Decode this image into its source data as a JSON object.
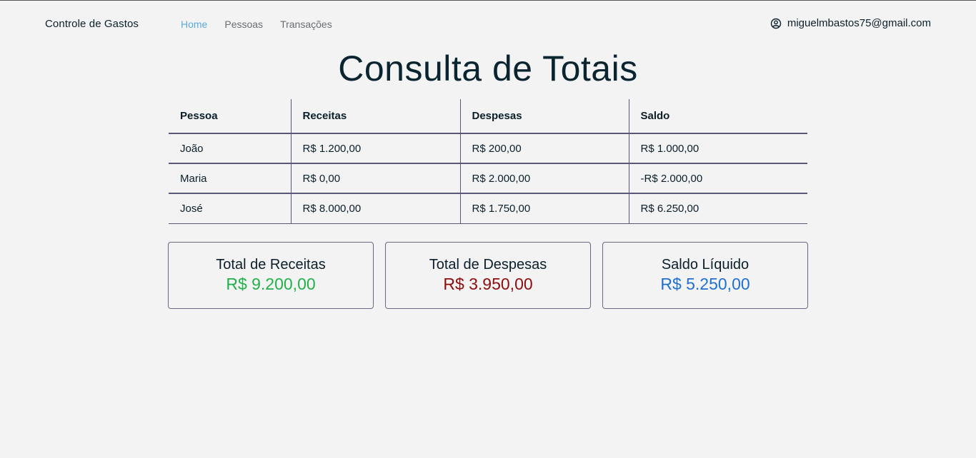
{
  "navbar": {
    "brand": "Controle de Gastos",
    "links": [
      {
        "label": "Home",
        "active": true
      },
      {
        "label": "Pessoas",
        "active": false
      },
      {
        "label": "Transações",
        "active": false
      }
    ],
    "user": {
      "icon": "user-circle-icon",
      "email": "miguelmbastos75@gmail.com"
    }
  },
  "main": {
    "title": "Consulta de Totais",
    "table": {
      "headers": [
        "Pessoa",
        "Receitas",
        "Despesas",
        "Saldo"
      ],
      "rows": [
        [
          "João",
          "R$ 1.200,00",
          "R$ 200,00",
          "R$ 1.000,00"
        ],
        [
          "Maria",
          "R$ 0,00",
          "R$ 2.000,00",
          "-R$ 2.000,00"
        ],
        [
          "José",
          "R$ 8.000,00",
          "R$ 1.750,00",
          "R$ 6.250,00"
        ]
      ]
    },
    "cards": [
      {
        "label": "Total de Receitas",
        "value": "R$ 9.200,00",
        "color": "#22b04a"
      },
      {
        "label": "Total de Despesas",
        "value": "R$ 3.950,00",
        "color": "#8b0d0d"
      },
      {
        "label": "Saldo Líquido",
        "value": "R$ 5.250,00",
        "color": "#1f6fd1"
      }
    ]
  },
  "colors": {
    "active_link": "#5aa9dd",
    "background": "#f3f3f3",
    "border": "#5a5878"
  }
}
